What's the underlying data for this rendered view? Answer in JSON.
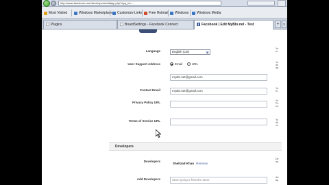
{
  "browser": {
    "url": "http://www.facebook.com/developers/editapp.php?app_id=...",
    "bookmarks": [
      {
        "label": "Most Visited",
        "color": "#e0a020"
      },
      {
        "label": "Windows Marketplace",
        "color": "#3a76c4"
      },
      {
        "label": "Customize Links",
        "color": "#3a76c4"
      },
      {
        "label": "Free Hotmail",
        "color": "#d04a2a"
      },
      {
        "label": "Windows",
        "color": "#3a76c4"
      },
      {
        "label": "Windows Media",
        "color": "#3a76c4"
      }
    ],
    "tabs": [
      {
        "label": "Plugins",
        "active": false
      },
      {
        "label": "BoardSettings - Facebook Connect",
        "active": false
      },
      {
        "label": "Facebook | Edit MyBlo.net - Test",
        "active": true
      }
    ],
    "new_tab_label": "+",
    "close_tab_label": "x"
  },
  "form": {
    "language_label": "Language",
    "language_value": "English (US)",
    "support_label": "User Support Address",
    "support_options": [
      "Email",
      "URL"
    ],
    "support_selected": "Email",
    "support_email_value": "mydtc.net@gmail.com",
    "contact_label": "Contact Email",
    "contact_value": "mydtc.net@gmail.com",
    "privacy_label": "Privacy Policy URL",
    "privacy_value": "",
    "tos_label": "Terms of Service URL",
    "tos_value": "",
    "developers_section": "Developers",
    "developers_label": "Developers",
    "developers_value": "Shehzad Khan",
    "developers_remove": "Remove",
    "add_developers_label": "Add Developers",
    "add_developers_placeholder": "Start typing a friend's name"
  },
  "help_texts": [
    {
      "lines": [
        "Yo",
        "m"
      ]
    },
    {
      "lines": [
        "Yo",
        "de",
        "ap"
      ]
    },
    {
      "lines": [
        "Yo",
        "m"
      ]
    },
    {
      "lines": [
        "Yo",
        "Po",
        "co"
      ]
    },
    {
      "lines": [
        "Yo",
        "de",
        "co"
      ]
    },
    {
      "lines": [
        "De",
        "ap"
      ]
    },
    {
      "lines": [
        "Ad",
        "ap"
      ]
    }
  ]
}
